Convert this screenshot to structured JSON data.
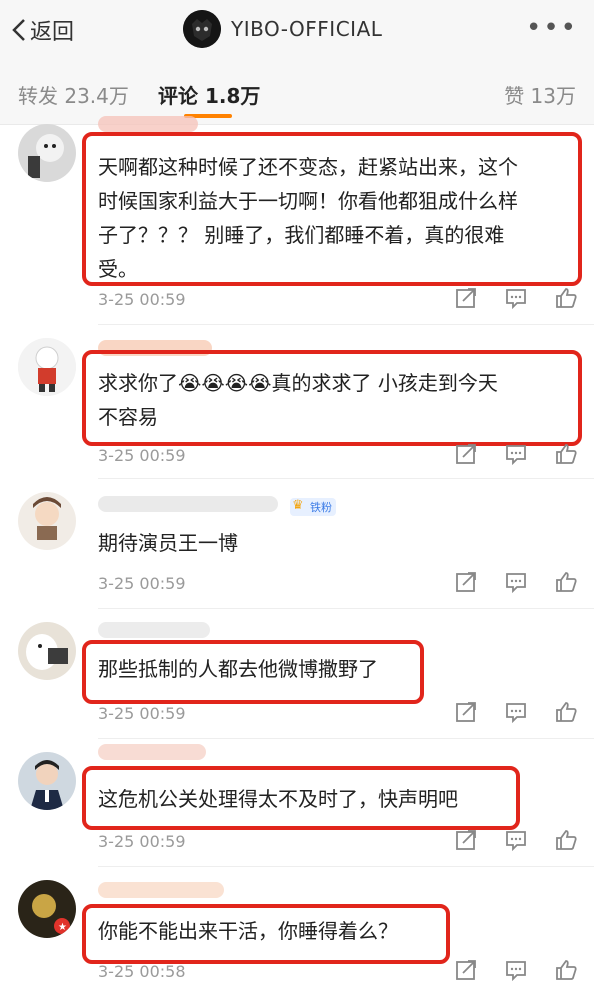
{
  "nav": {
    "back_label": "返回",
    "title": "YIBO-OFFICIAL",
    "more_label": "•••"
  },
  "tabs": {
    "repost": "转发 23.4万",
    "comments": "评论 1.8万",
    "likes": "赞 13万"
  },
  "comments": [
    {
      "text": "天啊都这种时候了还不变态，赶紧站出来，这个\n时候国家利益大于一切啊！你看他都狙成什么样\n子了？？？ 别睡了，我们都睡不着，真的很难\n受。",
      "time": "3-25 00:59"
    },
    {
      "text": "求求你了😭😭😭😭真的求求了  小孩走到今天\n不容易",
      "time": "3-25 00:59"
    },
    {
      "text": "期待演员王一博",
      "time": "3-25 00:59",
      "badge": "铁粉"
    },
    {
      "text": "那些抵制的人都去他微博撒野了",
      "time": "3-25 00:59"
    },
    {
      "text": "这危机公关处理得太不及时了，快声明吧",
      "time": "3-25 00:59"
    },
    {
      "text": "你能不能出来干活，你睡得着么？",
      "time": "3-25 00:58"
    }
  ],
  "colors": {
    "highlight": "#e1251b",
    "tab_underline": "#ff8200",
    "timestamp": "#9a9a9a"
  },
  "icons": [
    "chevron-left-icon",
    "more-icon",
    "share-icon",
    "comment-icon",
    "like-icon",
    "crown-icon"
  ]
}
